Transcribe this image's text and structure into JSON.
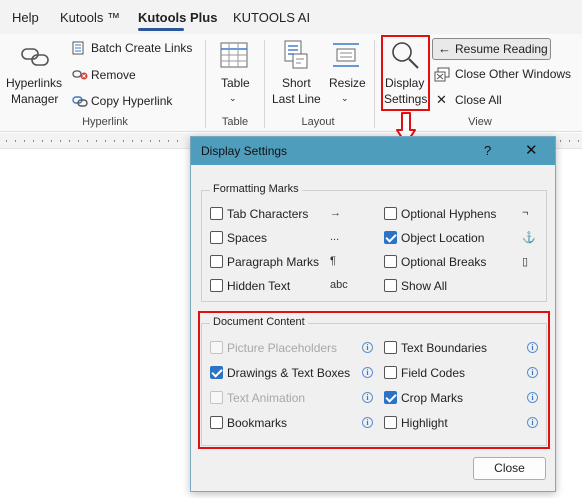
{
  "tabs": [
    "Help",
    "Kutools ™",
    "Kutools Plus",
    "KUTOOLS AI"
  ],
  "active_tab": "Kutools Plus",
  "ribbon": {
    "hyperlinks_manager": "Hyperlinks\nManager",
    "hyperlinks_line1": "Hyperlinks",
    "hyperlinks_line2": "Manager",
    "batch_create_links": "Batch Create Links",
    "remove": "Remove",
    "copy_hyperlink": "Copy Hyperlink",
    "group_hyperlink": "Hyperlink",
    "table": "Table",
    "group_table": "Table",
    "short_line1": "Short",
    "short_line2": "Last Line",
    "resize": "Resize",
    "group_layout": "Layout",
    "display_line1": "Display",
    "display_line2": "Settings",
    "resume_reading": "Resume Reading",
    "close_other_windows": "Close Other Windows",
    "close_all": "Close All",
    "group_view": "View"
  },
  "dialog": {
    "title": "Display Settings",
    "help": "?",
    "close_x": "✕",
    "formatting_marks": {
      "legend": "Formatting Marks",
      "left": [
        {
          "label": "Tab Characters",
          "checked": false,
          "symbol": "→"
        },
        {
          "label": "Spaces",
          "checked": false,
          "symbol": "..."
        },
        {
          "label": "Paragraph Marks",
          "checked": false,
          "symbol": "¶"
        },
        {
          "label": "Hidden Text",
          "checked": false,
          "symbol": "abc"
        }
      ],
      "right": [
        {
          "label": "Optional Hyphens",
          "checked": false,
          "symbol": "¬"
        },
        {
          "label": "Object Location",
          "checked": true,
          "symbol": "⚓"
        },
        {
          "label": "Optional Breaks",
          "checked": false,
          "symbol": "▯"
        },
        {
          "label": "Show All",
          "checked": false,
          "symbol": ""
        }
      ]
    },
    "document_content": {
      "legend": "Document Content",
      "left": [
        {
          "label": "Picture Placeholders",
          "checked": false,
          "disabled": true
        },
        {
          "label": "Drawings & Text Boxes",
          "checked": true,
          "disabled": false
        },
        {
          "label": "Text Animation",
          "checked": false,
          "disabled": true
        },
        {
          "label": "Bookmarks",
          "checked": false,
          "disabled": false
        }
      ],
      "right": [
        {
          "label": "Text Boundaries",
          "checked": false,
          "disabled": false
        },
        {
          "label": "Field Codes",
          "checked": false,
          "disabled": false
        },
        {
          "label": "Crop Marks",
          "checked": true,
          "disabled": false
        },
        {
          "label": "Highlight",
          "checked": false,
          "disabled": false
        }
      ]
    },
    "close_button": "Close"
  },
  "colors": {
    "accent": "#2b579a",
    "dialog_title": "#4f9dbd",
    "highlight_border": "#e01010",
    "checkbox_checked": "#2b73c4"
  }
}
